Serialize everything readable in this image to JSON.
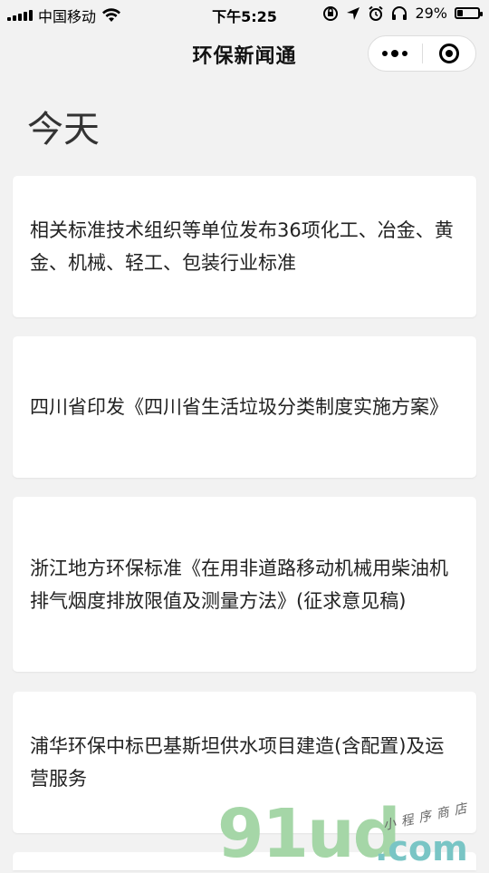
{
  "status_bar": {
    "carrier": "中国移动",
    "time": "下午5:25",
    "battery": "29%",
    "battery_level": 0.29
  },
  "nav": {
    "title": "环保新闻通"
  },
  "section": {
    "title": "今天"
  },
  "articles": [
    {
      "title": "相关标准技术组织等单位发布36项化工、冶金、黄金、机械、轻工、包装行业标准"
    },
    {
      "title": "四川省印发《四川省生活垃圾分类制度实施方案》"
    },
    {
      "title": "浙江地方环保标准《在用非道路移动机械用柴油机排气烟度排放限值及测量方法》(征求意见稿)"
    },
    {
      "title": "浦华环保中标巴基斯坦供水项目建造(含配置)及运营服务"
    }
  ],
  "watermark": {
    "main": "91ud",
    "com": ".com",
    "sub": "小程序商店"
  },
  "icons": {
    "wifi": "wifi-icon",
    "lock_rotation": "orientation-lock-icon",
    "location": "location-icon",
    "alarm": "alarm-icon",
    "headphones": "headphones-icon",
    "more": "more-dots-icon",
    "close": "target-close-icon"
  }
}
